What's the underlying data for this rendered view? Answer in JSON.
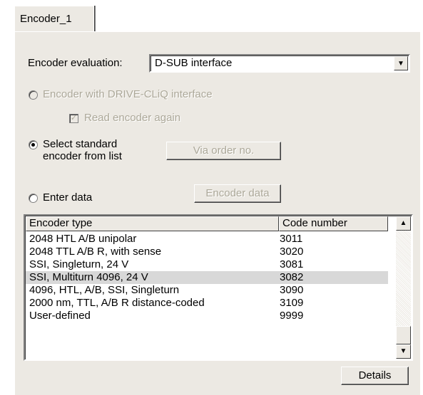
{
  "tab": {
    "label": "Encoder_1"
  },
  "evaluation": {
    "label": "Encoder evaluation:",
    "selected": "D-SUB interface"
  },
  "options": {
    "drivecliq_label": "Encoder with DRIVE-CLiQ interface",
    "read_again_label": "Read encoder again",
    "read_again_checked": true,
    "standard_label_line1": "Select standard",
    "standard_label_line2": "encoder from list",
    "enter_data_label": "Enter data",
    "selected_option": "standard"
  },
  "buttons": {
    "via_order": "Via order no.",
    "encoder_data": "Encoder data",
    "details": "Details"
  },
  "list": {
    "columns": [
      "Encoder type",
      "Code number"
    ],
    "rows": [
      {
        "type": "2048 HTL A/B unipolar",
        "code": "3011"
      },
      {
        "type": "2048 TTL A/B R, with sense",
        "code": "3020"
      },
      {
        "type": "SSI, Singleturn, 24 V",
        "code": "3081"
      },
      {
        "type": "SSI, Multiturn 4096, 24 V",
        "code": "3082",
        "selected": true
      },
      {
        "type": "4096, HTL, A/B, SSI, Singleturn",
        "code": "3090"
      },
      {
        "type": "2000 nm, TTL, A/B R distance-coded",
        "code": "3109"
      },
      {
        "type": "User-defined",
        "code": "9999"
      }
    ]
  },
  "icons": {
    "combo_arrow": "chevron-down-icon",
    "scroll_up": "scroll-up-icon",
    "scroll_down": "scroll-down-icon"
  },
  "colors": {
    "face": "#ece9e3",
    "disabled_text": "#aca899",
    "selection": "#d8d8d8"
  }
}
